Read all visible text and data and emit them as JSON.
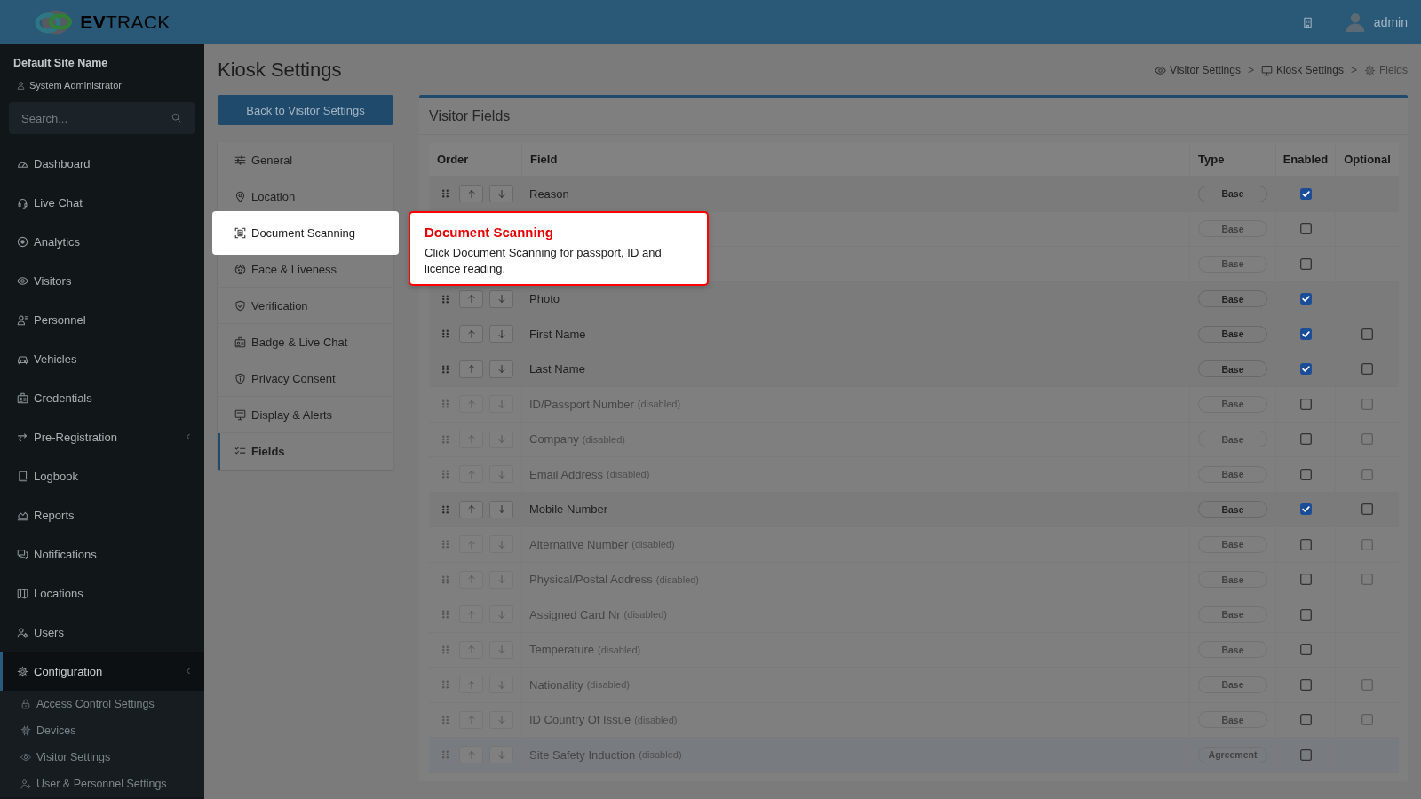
{
  "topbar": {
    "logo": "**EV**TRACK",
    "user": "admin"
  },
  "sidebar": {
    "site_name": "Default Site Name",
    "role": "System Administrator",
    "search": {
      "placeholder": "Search..."
    },
    "items": [
      {
        "label": "Dashboard",
        "selected": false,
        "expandable": false
      },
      {
        "label": "Live Chat",
        "selected": false,
        "expandable": false
      },
      {
        "label": "Analytics",
        "selected": false,
        "expandable": false
      },
      {
        "label": "Visitors",
        "selected": false,
        "expandable": false
      },
      {
        "label": "Personnel",
        "selected": false,
        "expandable": false
      },
      {
        "label": "Vehicles",
        "selected": false,
        "expandable": false
      },
      {
        "label": "Credentials",
        "selected": false,
        "expandable": false
      },
      {
        "label": "Pre-Registration",
        "selected": false,
        "expandable": true
      },
      {
        "label": "Logbook",
        "selected": false,
        "expandable": false
      },
      {
        "label": "Reports",
        "selected": false,
        "expandable": false
      },
      {
        "label": "Notifications",
        "selected": false,
        "expandable": false
      },
      {
        "label": "Locations",
        "selected": false,
        "expandable": false
      },
      {
        "label": "Users",
        "selected": false,
        "expandable": false
      },
      {
        "label": "Configuration",
        "selected": true,
        "expandable": true,
        "children": [
          {
            "label": "Access Control Settings",
            "selected": false
          },
          {
            "label": "Devices",
            "selected": false
          },
          {
            "label": "Visitor Settings",
            "selected": false
          },
          {
            "label": "User & Personnel Settings",
            "selected": false
          }
        ]
      }
    ]
  },
  "page": {
    "title": "Kiosk Settings",
    "breadcrumbs": [
      {
        "label": "Visitor Settings",
        "current": false
      },
      {
        "label": "Kiosk Settings",
        "current": false
      },
      {
        "label": "Fields",
        "current": true
      }
    ],
    "breadcrumb_separator": ">",
    "back_button": "Back to Visitor Settings"
  },
  "settings_menu": [
    {
      "label": "General",
      "selected": false,
      "highlighted": false
    },
    {
      "label": "Location",
      "selected": false,
      "highlighted": false
    },
    {
      "label": "Document Scanning",
      "selected": false,
      "highlighted": true
    },
    {
      "label": "Face & Liveness",
      "selected": false,
      "highlighted": false
    },
    {
      "label": "Verification",
      "selected": false,
      "highlighted": false
    },
    {
      "label": "Badge & Live Chat",
      "selected": false,
      "highlighted": false
    },
    {
      "label": "Privacy Consent",
      "selected": false,
      "highlighted": false
    },
    {
      "label": "Display & Alerts",
      "selected": false,
      "highlighted": false
    },
    {
      "label": "Fields",
      "selected": true,
      "highlighted": false
    }
  ],
  "tour_tooltip": {
    "title": "Document Scanning",
    "text": "Click Document Scanning for passport, ID and licence reading."
  },
  "card": {
    "title": "Visitor Fields",
    "columns": [
      "Order",
      "Field",
      "Type",
      "Enabled",
      "Optional"
    ],
    "rows": [
      {
        "field": "Reason",
        "disabled": false,
        "type": "Base",
        "kind": "base",
        "enabled": true
      },
      {
        "disabled": true,
        "type": "Base",
        "kind": "base",
        "enabled": false
      },
      {
        "disabled": true,
        "type": "Base",
        "kind": "base",
        "enabled": false
      },
      {
        "field": "Photo",
        "disabled": false,
        "type": "Base",
        "kind": "base",
        "enabled": true
      },
      {
        "field": "First Name",
        "disabled": false,
        "type": "Base",
        "kind": "base",
        "enabled": true,
        "optional": false
      },
      {
        "field": "Last Name",
        "disabled": false,
        "type": "Base",
        "kind": "base",
        "enabled": true,
        "optional": false
      },
      {
        "field": "ID/Passport Number",
        "note": "(disabled)",
        "disabled": true,
        "type": "Base",
        "kind": "base",
        "enabled": false,
        "optional": false
      },
      {
        "field": "Company",
        "note": "(disabled)",
        "disabled": true,
        "type": "Base",
        "kind": "base",
        "enabled": false,
        "optional": false
      },
      {
        "field": "Email Address",
        "note": "(disabled)",
        "disabled": true,
        "type": "Base",
        "kind": "base",
        "enabled": false,
        "optional": false
      },
      {
        "field": "Mobile Number",
        "disabled": false,
        "type": "Base",
        "kind": "base",
        "enabled": true,
        "optional": false
      },
      {
        "field": "Alternative Number",
        "note": "(disabled)",
        "disabled": true,
        "type": "Base",
        "kind": "base",
        "enabled": false,
        "optional": false
      },
      {
        "field": "Physical/Postal Address",
        "note": "(disabled)",
        "disabled": true,
        "type": "Base",
        "kind": "base",
        "enabled": false,
        "optional": false
      },
      {
        "field": "Assigned Card Nr",
        "note": "(disabled)",
        "disabled": true,
        "type": "Base",
        "kind": "base",
        "enabled": false
      },
      {
        "field": "Temperature",
        "note": "(disabled)",
        "disabled": true,
        "type": "Base",
        "kind": "base",
        "enabled": false
      },
      {
        "field": "Nationality",
        "note": "(disabled)",
        "disabled": true,
        "type": "Base",
        "kind": "base",
        "enabled": false,
        "optional": false
      },
      {
        "field": "ID Country Of Issue",
        "note": "(disabled)",
        "disabled": true,
        "type": "Base",
        "kind": "base",
        "enabled": false,
        "optional": false
      },
      {
        "field": "Site Safety Induction",
        "note": "(disabled)",
        "disabled": true,
        "type": "Agreement",
        "kind": "agreement",
        "enabled": false
      }
    ]
  }
}
